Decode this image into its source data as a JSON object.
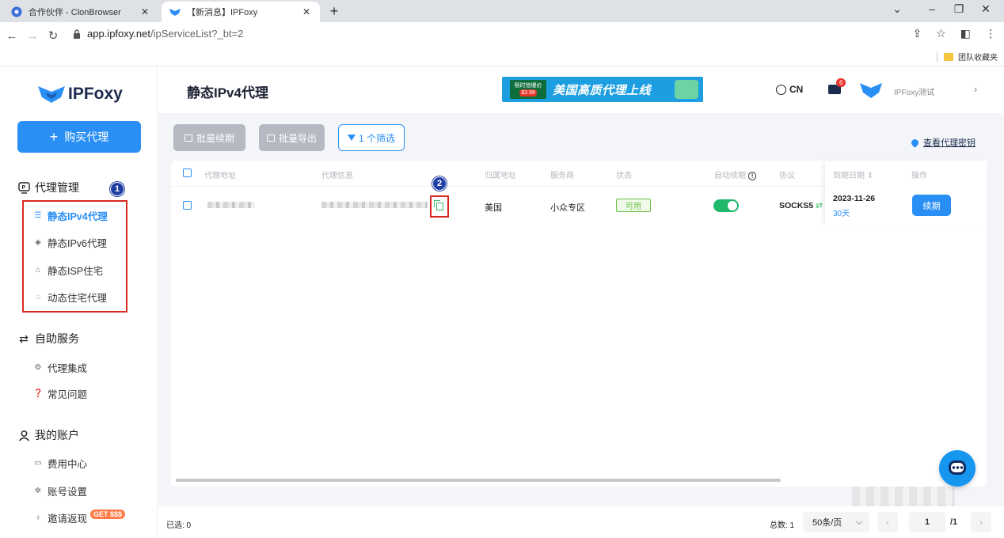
{
  "browser": {
    "tabs": [
      {
        "title": "合作伙伴 - ClonBrowser"
      },
      {
        "title": "【新消息】IPFoxy"
      }
    ],
    "url_host": "app.ipfoxy.net",
    "url_path": "/ipServiceList?_bt=2",
    "bookmark": "团队收藏夹"
  },
  "sidebar": {
    "logo": "IPFoxy",
    "buy_button": "购买代理",
    "sections": [
      {
        "label": "代理管理",
        "items": [
          "静态IPv4代理",
          "静态IPv6代理",
          "静态ISP住宅",
          "动态住宅代理"
        ]
      },
      {
        "label": "自助服务",
        "items": [
          "代理集成",
          "常见问题"
        ]
      },
      {
        "label": "我的账户",
        "items": [
          "费用中心",
          "账号设置",
          "邀请返现"
        ]
      }
    ],
    "badge": "GET $$$",
    "marker1": "1"
  },
  "header": {
    "title": "静态IPv4代理",
    "banner_tag": "限时惊爆价",
    "banner_price": "$3.99",
    "banner_text": "美国高质代理上线",
    "lang": "CN",
    "msg_count": "6",
    "username": "IPFoxy测试"
  },
  "toolbar": {
    "batch_renew": "批量续期",
    "batch_export": "批量导出",
    "filter": "1 个筛选",
    "key_link": "查看代理密钥"
  },
  "table": {
    "columns": [
      "代理地址",
      "代理信息",
      "归属地址",
      "服务商",
      "状态",
      "自动续期",
      "协议",
      "到期日期",
      "操作"
    ],
    "rows": [
      {
        "region": "美国",
        "provider": "小众专区",
        "status": "可用",
        "auto_renew": true,
        "protocol": "SOCKS5",
        "expiry": "2023-11-26",
        "days": "30天",
        "action": "续期"
      }
    ],
    "marker2": "2"
  },
  "footer": {
    "selected": "已选: 0",
    "total": "总数: 1",
    "page_size": "50条/页",
    "page": "1",
    "page_total": "/1"
  }
}
